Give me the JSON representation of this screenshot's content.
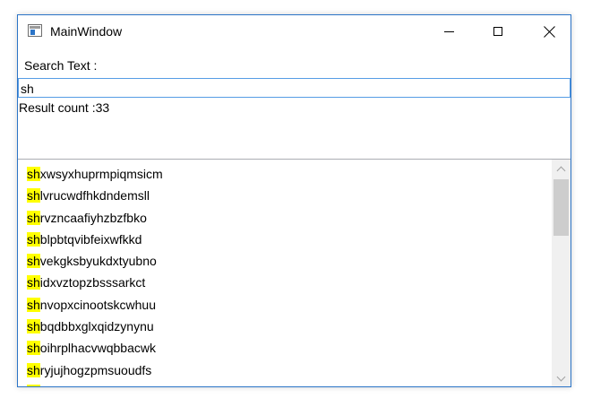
{
  "window": {
    "title": "MainWindow"
  },
  "search": {
    "label": "Search Text :",
    "value": "sh"
  },
  "result": {
    "text": "Result count :33"
  },
  "highlight_color": "#ffff00",
  "list": {
    "prefix": "sh",
    "items": [
      "xwsyxhuprmpiqmsicm",
      "lvrucwdfhkdndemsll",
      "rvzncaafiyhzbzfbko",
      "blpbtqvibfeixwfkkd",
      "vekgksbyukdxtyubno",
      "idxvztopzbsssarkct",
      "nvopxcinootskcwhuu",
      "bqdbbxglxqidzynynu",
      "oihrplhacvwqbbacwk",
      "ryjujhogzpmsuoudfs",
      "..."
    ]
  },
  "scrollbar": {
    "position": 0.0
  }
}
